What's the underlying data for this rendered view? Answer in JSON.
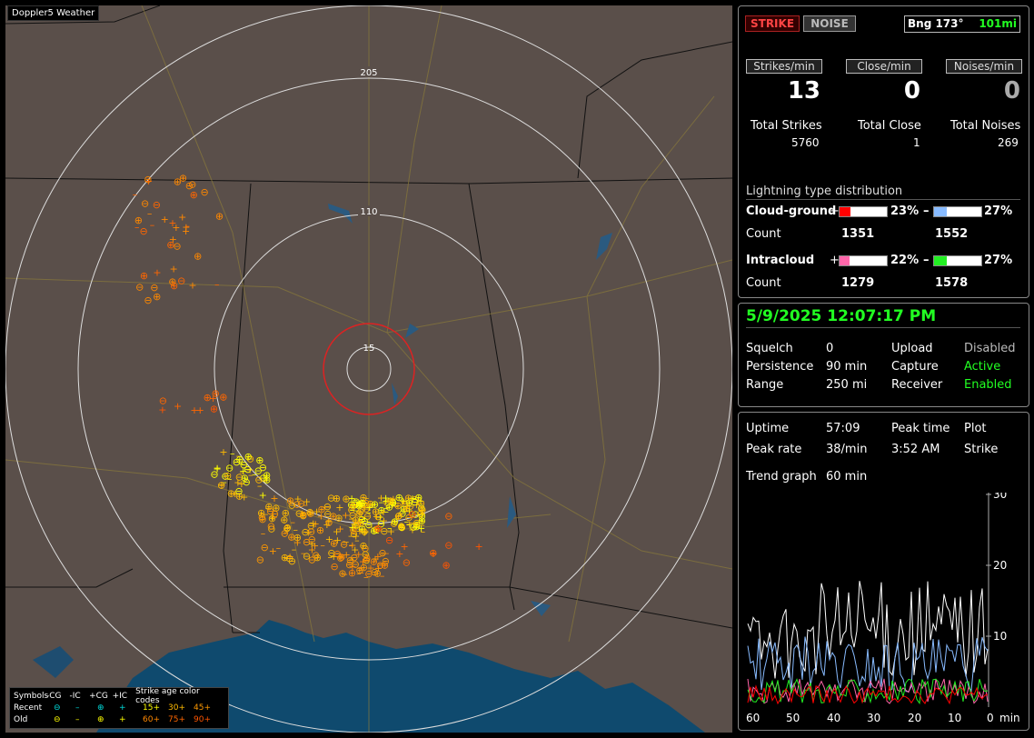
{
  "map": {
    "title": "Doppler5 Weather",
    "ring_labels": [
      "205",
      "110",
      "15"
    ]
  },
  "legend": {
    "symbols_label": "Symbols",
    "col_minus_cg": "-CG",
    "col_minus_ic": "-IC",
    "col_plus_cg": "+CG",
    "col_plus_ic": "+IC",
    "age_title": "Strike age color codes",
    "recent_label": "Recent",
    "old_label": "Old",
    "ages_recent": [
      "15+",
      "30+",
      "45+"
    ],
    "ages_old": [
      "60+",
      "75+",
      "90+"
    ],
    "age_colors": [
      "#ffff00",
      "#ffbb00",
      "#ff9900",
      "#ff8800",
      "#ff6600",
      "#ff5500"
    ]
  },
  "header": {
    "strike_label": "STRIKE",
    "noise_label": "NOISE",
    "bearing": "Bng 173°",
    "distance": "101mi"
  },
  "rates": {
    "strikes_label": "Strikes/min",
    "close_label": "Close/min",
    "noises_label": "Noises/min",
    "strikes": "13",
    "close": "0",
    "noises": "0",
    "total_strikes_label": "Total Strikes",
    "total_close_label": "Total Close",
    "total_noises_label": "Total Noises",
    "total_strikes": "5760",
    "total_close": "1",
    "total_noises": "269"
  },
  "distribution": {
    "title": "Lightning type distribution",
    "cg_label": "Cloud-ground",
    "ic_label": "Intracloud",
    "count_label": "Count",
    "plus": "+",
    "minus": "–",
    "cg_plus_pct": "23%",
    "cg_minus_pct": "27%",
    "ic_plus_pct": "22%",
    "ic_minus_pct": "27%",
    "cg_plus_fraction": 0.23,
    "cg_minus_fraction": 0.27,
    "ic_plus_fraction": 0.22,
    "ic_minus_fraction": 0.27,
    "cg_plus_count": "1351",
    "cg_minus_count": "1552",
    "ic_plus_count": "1279",
    "ic_minus_count": "1578",
    "colors": {
      "cg_plus": "#ff0000",
      "cg_minus": "#88bbff",
      "ic_plus": "#ff66aa",
      "ic_minus": "#22ee22"
    }
  },
  "status": {
    "datetime": "5/9/2025 12:07:17 PM",
    "squelch_label": "Squelch",
    "squelch": "0",
    "persistence_label": "Persistence",
    "persistence": "90 min",
    "range_label": "Range",
    "range": "250 mi",
    "upload_label": "Upload",
    "upload": "Disabled",
    "capture_label": "Capture",
    "capture": "Active",
    "receiver_label": "Receiver",
    "receiver": "Enabled"
  },
  "trend": {
    "uptime_label": "Uptime",
    "uptime": "57:09",
    "peak_time_label": "Peak time",
    "peak_time": "3:52 AM",
    "plot_label": "Plot",
    "peak_rate_label": "Peak rate",
    "peak_rate": "38/min",
    "plot_value": "Strike",
    "trend_label": "Trend graph",
    "trend_value": "60 min",
    "y_ticks": [
      "30",
      "20",
      "10"
    ],
    "x_ticks": [
      "60",
      "50",
      "40",
      "30",
      "20",
      "10",
      "0"
    ],
    "x_unit": "min"
  }
}
